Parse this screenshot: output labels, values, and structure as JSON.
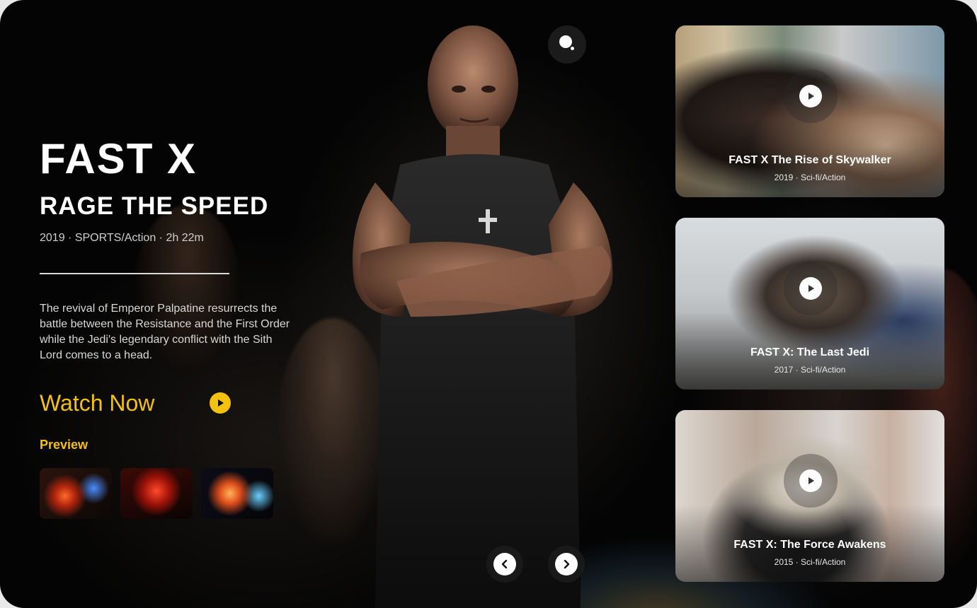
{
  "hero": {
    "title": "FAST X",
    "subtitle": "RAGE THE SPEED",
    "meta": "2019 · SPORTS/Action · 2h 22m",
    "description": "The revival of Emperor Palpatine resurrects the battle between the Resistance and the First Order while the Jedi's legendary conflict with the Sith Lord comes to a head.",
    "watch_label": "Watch Now"
  },
  "preview": {
    "label": "Preview"
  },
  "cards": [
    {
      "title": "FAST X The Rise of Skywalker",
      "meta": "2019 · Sci-fi/Action"
    },
    {
      "title": "FAST X: The Last Jedi",
      "meta": "2017 · Sci-fi/Action"
    },
    {
      "title": "FAST X: The Force Awakens",
      "meta": "2015 · Sci-fi/Action"
    }
  ],
  "icons": {
    "search": "search-icon",
    "play": "play-icon",
    "prev": "chevron-left-icon",
    "next": "chevron-right-icon"
  },
  "colors": {
    "accent": "#f4c10f",
    "background": "#040404",
    "text": "#ffffff"
  }
}
